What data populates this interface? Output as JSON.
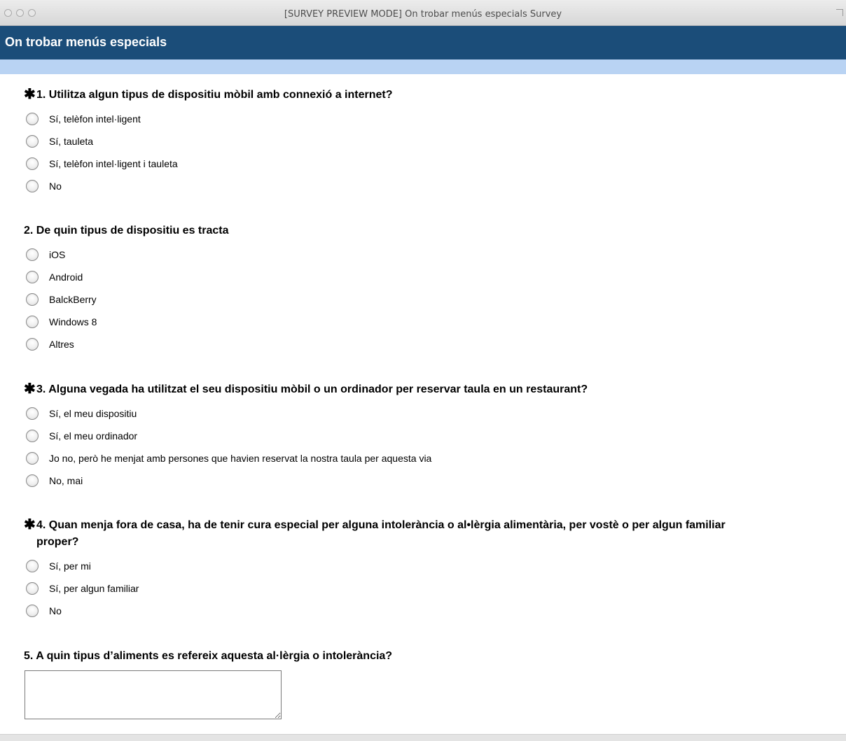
{
  "window": {
    "title": "[SURVEY PREVIEW MODE] On trobar menús especials Survey"
  },
  "survey": {
    "title": "On trobar menús especials"
  },
  "colors": {
    "header_bg": "#1b4d79",
    "progress_band": "#b9d3f3"
  },
  "questions": [
    {
      "required": true,
      "star": "✱",
      "text": "1. Utilitza algun tipus de dispositiu mòbil amb connexió a internet?",
      "options": [
        "Sí, telèfon intel·ligent",
        "Sí, tauleta",
        "Sí, telèfon intel·ligent i tauleta",
        "No"
      ]
    },
    {
      "required": false,
      "text": "2. De quin tipus de dispositiu es tracta",
      "options": [
        "iOS",
        "Android",
        "BalckBerry",
        "Windows 8",
        "Altres"
      ]
    },
    {
      "required": true,
      "star": "✱",
      "text": "3. Alguna vegada ha utilitzat el seu dispositiu mòbil o un ordinador per reservar taula en un restaurant?",
      "options": [
        "Sí, el meu dispositiu",
        "Sí, el meu ordinador",
        "Jo no, però he menjat amb persones que havien reservat la nostra taula per aquesta via",
        "No, mai"
      ]
    },
    {
      "required": true,
      "star": "✱",
      "text_line1": "4. Quan menja fora de casa, ha de tenir cura especial per alguna intolerància o al•lèrgia alimentària, per vostè o per algun familiar",
      "text_line2": "proper?",
      "options": [
        "Sí, per mi",
        "Sí, per algun familiar",
        "No"
      ]
    },
    {
      "required": false,
      "text": "5. A quin tipus d’aliments es refereix aquesta al·lèrgia o intolerància?",
      "answer": ""
    }
  ]
}
